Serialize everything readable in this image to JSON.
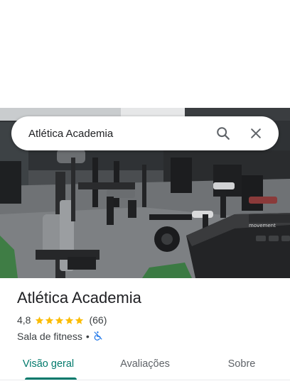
{
  "search": {
    "query": "Atlética Academia",
    "search_icon": "search-icon",
    "clear_icon": "close-icon"
  },
  "place": {
    "name": "Atlética Academia",
    "rating": "4,8",
    "stars": 4.8,
    "reviews": "(66)",
    "category": "Sala de fitness",
    "separator": "•",
    "accessibility_icon": "wheelchair-inaccessible-icon"
  },
  "tabs": [
    {
      "label": "Visão geral",
      "active": true
    },
    {
      "label": "Avaliações",
      "active": false
    },
    {
      "label": "Sobre",
      "active": false
    }
  ],
  "colors": {
    "accent": "#00796b",
    "star": "#fbbc04",
    "accessibility_icon": "#1a73e8"
  }
}
